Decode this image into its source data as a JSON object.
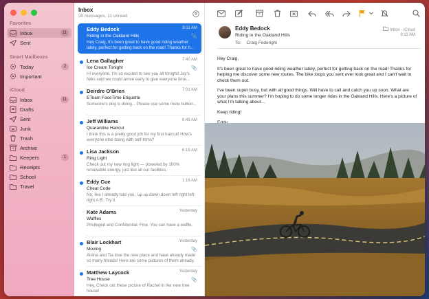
{
  "sidebar": {
    "favorites_title": "Favorites",
    "smart_title": "Smart Mailboxes",
    "icloud_title": "iCloud",
    "favorites": [
      {
        "label": "Inbox",
        "badge": "11",
        "icon": "inbox-icon",
        "selected": true
      },
      {
        "label": "Sent",
        "badge": "",
        "icon": "sent-icon"
      }
    ],
    "smart": [
      {
        "label": "Today",
        "badge": "2",
        "icon": "gear-icon"
      },
      {
        "label": "Important",
        "badge": "",
        "icon": "gear-icon"
      }
    ],
    "icloud": [
      {
        "label": "Inbox",
        "badge": "11",
        "icon": "inbox-icon"
      },
      {
        "label": "Drafts",
        "badge": "",
        "icon": "drafts-icon"
      },
      {
        "label": "Sent",
        "badge": "",
        "icon": "sent-icon"
      },
      {
        "label": "Junk",
        "badge": "",
        "icon": "junk-icon"
      },
      {
        "label": "Trash",
        "badge": "",
        "icon": "trash-icon"
      },
      {
        "label": "Archive",
        "badge": "",
        "icon": "archive-icon"
      },
      {
        "label": "Keepers",
        "badge": "1",
        "icon": "folder-icon"
      },
      {
        "label": "Receipts",
        "badge": "",
        "icon": "folder-icon"
      },
      {
        "label": "School",
        "badge": "",
        "icon": "folder-icon"
      },
      {
        "label": "Travel",
        "badge": "",
        "icon": "folder-icon"
      }
    ]
  },
  "list": {
    "title": "Inbox",
    "subtitle": "30 messages, 11 unread",
    "messages": [
      {
        "sender": "Eddy Bedock",
        "date": "9:11 AM",
        "subject": "Riding in the Oakland Hills",
        "preview": "Hey Craig, It's been great to have good riding weather lately, perfect for getting back on the road! Thanks for h...",
        "unread": false,
        "attachment": true,
        "selected": true
      },
      {
        "sender": "Lena Gallagher",
        "date": "7:40 AM",
        "subject": "Ice Cream Tonight",
        "preview": "Hi everyone, I'm so excited to see you all tonight! Jay's folks said we could arrive early to give everyone time...",
        "unread": true,
        "attachment": true
      },
      {
        "sender": "Deirdre O'Brien",
        "date": "7:01 AM",
        "subject": "ETeam FaceTime Etiquette",
        "preview": "Someone's dog is doing... Please use some mute button...",
        "unread": true,
        "attachment": false
      },
      {
        "sender": "Jeff Williams",
        "date": "6:45 AM",
        "subject": "Quarantine Haircut",
        "preview": "I think this is a pretty good job for my first haircut! How's everyone else doing with self-trims?",
        "unread": true,
        "attachment": false
      },
      {
        "sender": "Lisa Jackson",
        "date": "6:16 AM",
        "subject": "Ring Light",
        "preview": "Check out my new ring light — powered by 100% renewable energy, just like all our facilities.",
        "unread": true,
        "attachment": false
      },
      {
        "sender": "Eddy Cue",
        "date": "1:16 AM",
        "subject": "Cheat Code",
        "preview": "No, like I already told you, 'up up down down left right left right A B'. Try it.",
        "unread": true,
        "attachment": false
      },
      {
        "sender": "Kate Adams",
        "date": "Yesterday",
        "subject": "Waffles",
        "preview": "Privileged and Confidential. Fine. You can have a waffle.",
        "unread": false,
        "attachment": false
      },
      {
        "sender": "Blair Lockhart",
        "date": "Yesterday",
        "subject": "Moving",
        "preview": "Alisha and Tia love the new place and have already made so many friends! Here are some pictures of them already.",
        "unread": true,
        "attachment": true
      },
      {
        "sender": "Matthew Laycock",
        "date": "Yesterday",
        "subject": "Tree House",
        "preview": "Hey, Check out these picture of Rachel in her new tree house!",
        "unread": true,
        "attachment": true
      }
    ]
  },
  "message": {
    "from": "Eddy Bedock",
    "subject": "Riding in the Oakland Hills",
    "to_label": "To:",
    "to": "Craig Federighi",
    "mailbox": "Inbox - iCloud",
    "time": "9:11 AM",
    "body": [
      "Hey Craig,",
      "It's been great to have good riding weather lately, perfect for getting back on the road! Thanks for helping me discover some new routes. The bike loops you sent over look great and I can't wait to check them out.",
      "I've been super busy, but with all good things. Will have to call and catch you up soon. What are your plans this summer? I'm hoping to do some longer rides in the Oakland Hills. Here's a picture of what I'm talking about…",
      "Keep riding!",
      "Eddy"
    ]
  },
  "toolbar": {
    "icons": [
      "filter-icon",
      "envelope-icon",
      "compose-icon",
      "archive-icon",
      "trash-icon",
      "junk-icon",
      "reply-icon",
      "reply-all-icon",
      "forward-icon",
      "flag-icon",
      "mute-icon",
      "search-icon"
    ]
  },
  "colors": {
    "accent": "#1e73e8",
    "flag": "#f39c12"
  }
}
